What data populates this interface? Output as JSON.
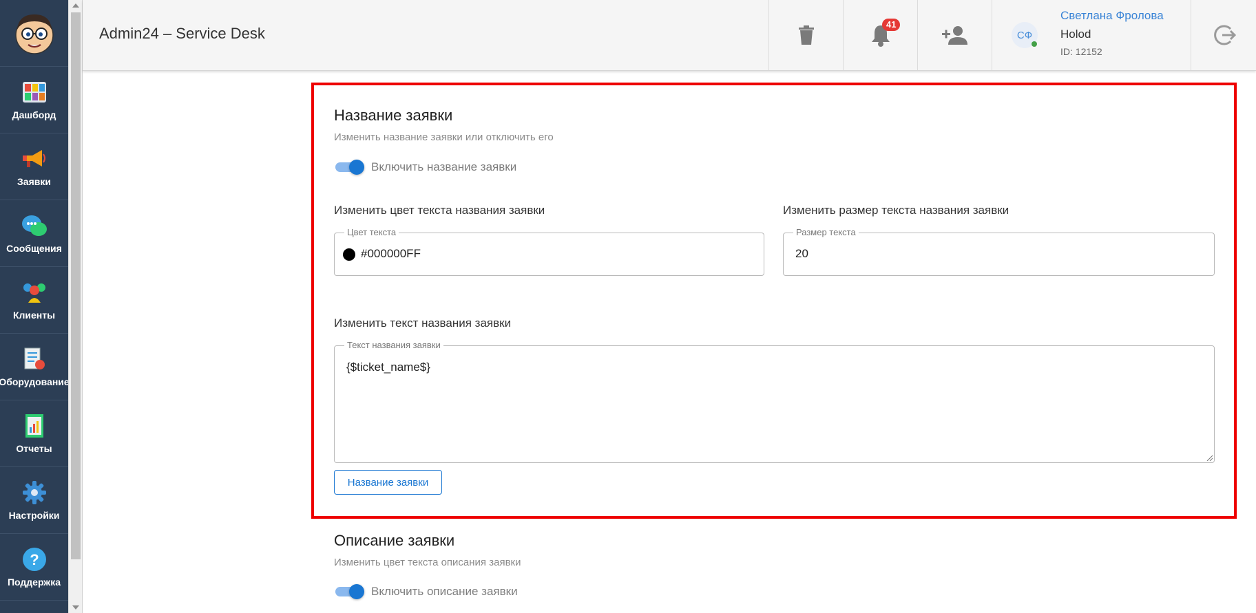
{
  "sidebar": {
    "logo_icon": "cartoon-face-logo",
    "items": [
      {
        "label": "Дашборд",
        "icon": "dashboard-tiles-icon"
      },
      {
        "label": "Заявки",
        "icon": "megaphone-icon"
      },
      {
        "label": "Сообщения",
        "icon": "chat-bubbles-icon"
      },
      {
        "label": "Клиенты",
        "icon": "people-group-icon"
      },
      {
        "label": "Оборудование",
        "icon": "equipment-checklist-icon"
      },
      {
        "label": "Отчеты",
        "icon": "report-chart-icon"
      },
      {
        "label": "Настройки",
        "icon": "gear-icon"
      },
      {
        "label": "Поддержка",
        "icon": "help-question-icon"
      }
    ]
  },
  "header": {
    "title": "Admin24 – Service Desk",
    "notifications_count": "41",
    "user": {
      "initials": "СФ",
      "name": "Светлана Фролова",
      "company": "Holod",
      "id": "ID: 12152"
    }
  },
  "ticket_name": {
    "title": "Название заявки",
    "subtitle": "Изменить название заявки или отключить его",
    "toggle_label": "Включить название заявки",
    "toggle_on": true,
    "color_label": "Изменить цвет текста названия заявки",
    "color_legend": "Цвет текста",
    "color_value": "#000000FF",
    "size_label": "Изменить размер текста названия заявки",
    "size_legend": "Размер текста",
    "size_value": "20",
    "text_label": "Изменить текст названия заявки",
    "text_legend": "Текст названия заявки",
    "text_value": "{$ticket_name$}",
    "insert_button": "Название заявки"
  },
  "ticket_description": {
    "title": "Описание заявки",
    "subtitle": "Изменить цвет текста описания заявки",
    "toggle_label": "Включить описание заявки",
    "toggle_on": true
  },
  "colors": {
    "sidebar_bg": "#2c3e55",
    "accent": "#1976d2",
    "highlight": "#ee0000",
    "badge": "#e53935"
  }
}
